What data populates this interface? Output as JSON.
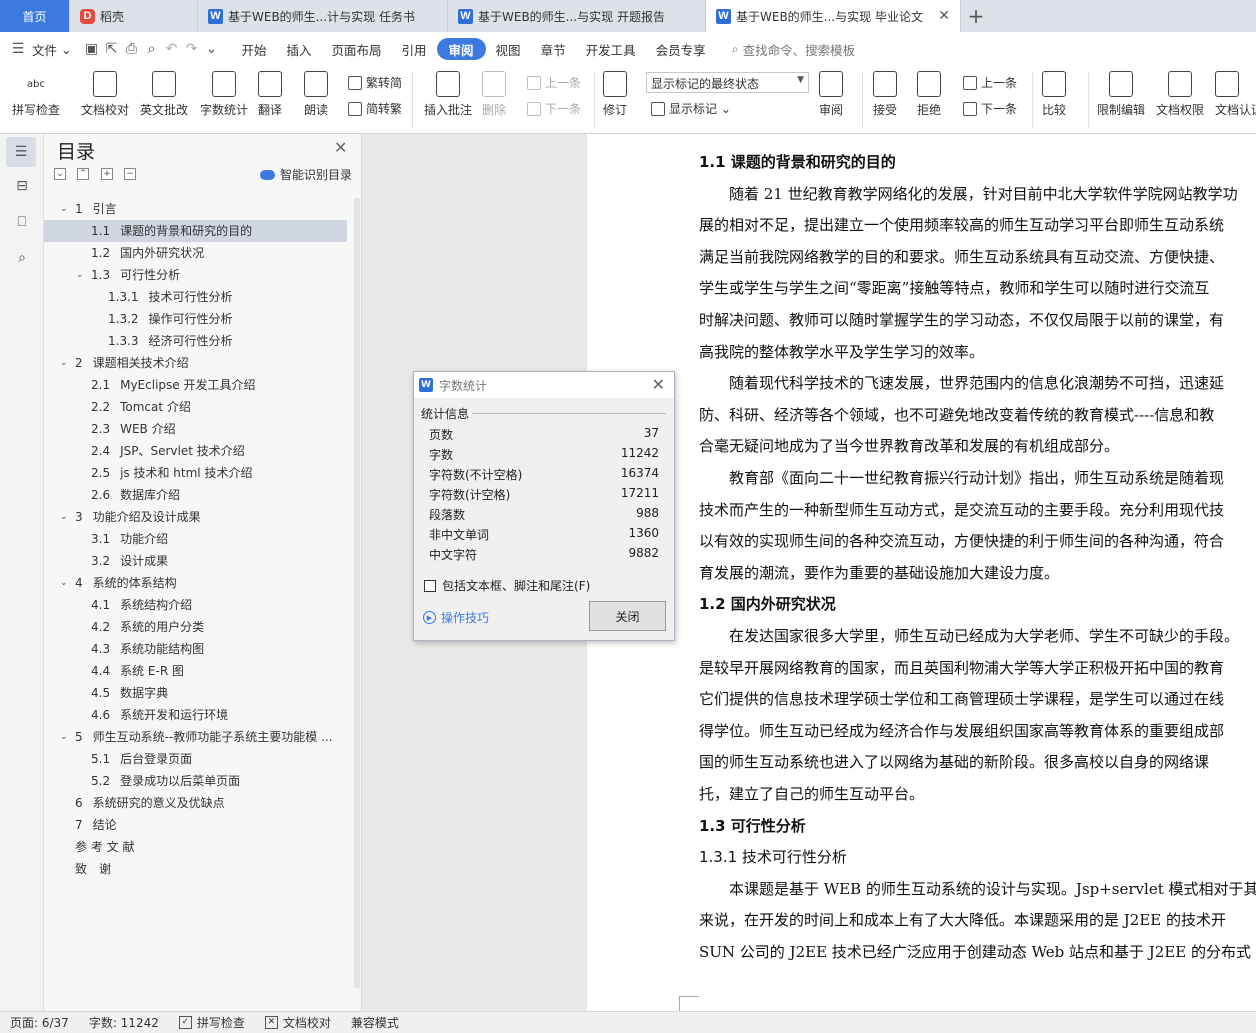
{
  "tabs": {
    "home": "首页",
    "daoke": "稻壳",
    "doc1": "基于WEB的师生...计与实现 任务书",
    "doc2": "基于WEB的师生...与实现 开题报告",
    "doc3": "基于WEB的师生...与实现 毕业论文",
    "close_glyph": "✕",
    "add_glyph": "+"
  },
  "menu": {
    "file": "文件",
    "items": [
      "开始",
      "插入",
      "页面布局",
      "引用",
      "审阅",
      "视图",
      "章节",
      "开发工具",
      "会员专享"
    ],
    "active": "审阅",
    "search": "查找命令、搜索模板"
  },
  "ribbon": {
    "spellcheck": "拼写检查",
    "proofread": "文档校对",
    "en_review": "英文批改",
    "wordcount": "字数统计",
    "translate": "翻译",
    "read_aloud": "朗读",
    "trad_to_simp": "繁转简",
    "simp_to_trad": "简转繁",
    "insert_comment": "插入批注",
    "delete": "删除",
    "prev": "上一条",
    "next": "下一条",
    "track": "修订",
    "markup_state": "显示标记的最终状态",
    "show_markup": "显示标记",
    "review": "审阅",
    "accept": "接受",
    "reject": "拒绝",
    "prev2": "上一条",
    "next2": "下一条",
    "compare": "比较",
    "restrict": "限制编辑",
    "permission": "文档权限",
    "doc_auth": "文档认证",
    "icon_abc": "abc"
  },
  "toc": {
    "title": "目录",
    "smart": "智能识别目录",
    "items": [
      {
        "num": "1",
        "text": "引言"
      },
      {
        "num": "1.1",
        "text": "课题的背景和研究的目的"
      },
      {
        "num": "1.2",
        "text": "国内外研究状况"
      },
      {
        "num": "1.3",
        "text": "可行性分析"
      },
      {
        "num": "1.3.1",
        "text": "技术可行性分析"
      },
      {
        "num": "1.3.2",
        "text": "操作可行性分析"
      },
      {
        "num": "1.3.3",
        "text": "经济可行性分析"
      },
      {
        "num": "2",
        "text": "课题相关技术介绍"
      },
      {
        "num": "2.1",
        "text": "MyEclipse 开发工具介绍"
      },
      {
        "num": "2.2",
        "text": "Tomcat 介绍"
      },
      {
        "num": "2.3",
        "text": "WEB 介绍"
      },
      {
        "num": "2.4",
        "text": "JSP、Servlet 技术介绍"
      },
      {
        "num": "2.5",
        "text": "js 技术和 html 技术介绍"
      },
      {
        "num": "2.6",
        "text": "数据库介绍"
      },
      {
        "num": "3",
        "text": "功能介绍及设计成果"
      },
      {
        "num": "3.1",
        "text": "功能介绍"
      },
      {
        "num": "3.2",
        "text": "设计成果"
      },
      {
        "num": "4",
        "text": "系统的体系结构"
      },
      {
        "num": "4.1",
        "text": "系统结构介绍"
      },
      {
        "num": "4.2",
        "text": "系统的用户分类"
      },
      {
        "num": "4.3",
        "text": "系统功能结构图"
      },
      {
        "num": "4.4",
        "text": "系统 E-R 图"
      },
      {
        "num": "4.5",
        "text": "数据字典"
      },
      {
        "num": "4.6",
        "text": "系统开发和运行环境"
      },
      {
        "num": "5",
        "text": "师生互动系统--教师功能子系统主要功能模 ..."
      },
      {
        "num": "5.1",
        "text": "后台登录页面"
      },
      {
        "num": "5.2",
        "text": "登录成功以后菜单页面"
      },
      {
        "num": "6",
        "text": "系统研究的意义及优缺点"
      },
      {
        "num": "7",
        "text": "结论"
      },
      {
        "num": "",
        "text": "参 考 文 献"
      },
      {
        "num": "",
        "text": "致　谢"
      }
    ]
  },
  "document": {
    "lines": [
      "1.1   课题的背景和研究的目的",
      "随着 21 世纪教育教学网络化的发展，针对目前中北大学软件学院网站教学功",
      "展的相对不足，提出建立一个使用频率较高的师生互动学习平台即师生互动系统",
      "满足当前我院网络教学的目的和要求。师生互动系统具有互动交流、方便快捷、",
      "学生或学生与学生之间“零距离”接触等特点，教师和学生可以随时进行交流互",
      "时解决问题、教师可以随时掌握学生的学习动态，不仅仅局限于以前的课堂，有",
      "高我院的整体教学水平及学生学习的效率。",
      "随着现代科学技术的飞速发展，世界范围内的信息化浪潮势不可挡，迅速延",
      "防、科研、经济等各个领域，也不可避免地改变着传统的教育模式----信息和教",
      "合毫无疑问地成为了当今世界教育改革和发展的有机组成部分。",
      "教育部《面向二十一世纪教育振兴行动计划》指出，师生互动系统是随着现",
      "技术而产生的一种新型师生互动方式，是交流互动的主要手段。充分利用现代技",
      "以有效的实现师生间的各种交流互动，方便快捷的利于师生间的各种沟通，符合",
      "育发展的潮流，要作为重要的基础设施加大建设力度。",
      "1.2   国内外研究状况",
      "在发达国家很多大学里，师生互动已经成为大学老师、学生不可缺少的手段。",
      "是较早开展网络教育的国家，而且英国利物浦大学等大学正积极开拓中国的教育",
      "它们提供的信息技术理学硕士学位和工商管理硕士学课程，是学生可以通过在线",
      "得学位。师生互动已经成为经济合作与发展组织国家高等教育体系的重要组成部",
      "国的师生互动系统也进入了以网络为基础的新阶段。很多高校以自身的网络课",
      "托，建立了自己的师生互动平台。",
      "1.3   可行性分析",
      "1.3.1   技术可行性分析",
      "本课题是基于 WEB 的师生互动系统的设计与实现。Jsp+servlet 模式相对于其",
      "来说，在开发的时间上和成本上有了大大降低。本课题采用的是 J2EE 的技术开",
      "SUN 公司的 J2EE 技术已经广泛应用于创建动态 Web 站点和基于 J2EE 的分布式"
    ]
  },
  "dialog": {
    "title": "字数统计",
    "group": "统计信息",
    "stats": [
      {
        "label": "页数",
        "value": "37"
      },
      {
        "label": "字数",
        "value": "11242"
      },
      {
        "label": "字符数(不计空格)",
        "value": "16374"
      },
      {
        "label": "字符数(计空格)",
        "value": "17211"
      },
      {
        "label": "段落数",
        "value": "988"
      },
      {
        "label": "非中文单词",
        "value": "1360"
      },
      {
        "label": "中文字符",
        "value": "9882"
      }
    ],
    "checkbox": "包括文本框、脚注和尾注(F)",
    "tips": "操作技巧",
    "close": "关闭"
  },
  "status": {
    "page": "页面: 6/37",
    "words": "字数: 11242",
    "spell": "拼写检查",
    "proof": "文档校对",
    "compat": "兼容模式"
  },
  "colors": {
    "accent": "#3d7ae0",
    "tab_bar": "#dde1e8"
  }
}
